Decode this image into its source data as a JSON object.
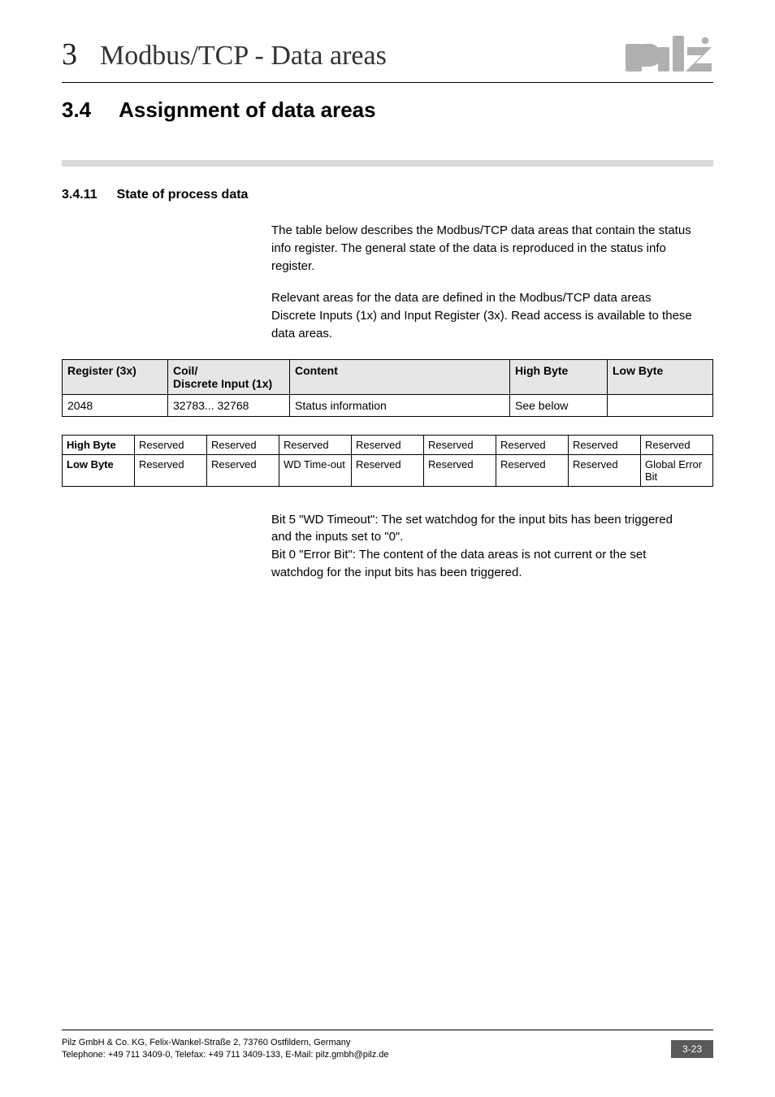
{
  "header": {
    "chapter_num": "3",
    "chapter_title": "Modbus/TCP - Data areas"
  },
  "section": {
    "num": "3.4",
    "title": "Assignment of data areas"
  },
  "subsection": {
    "num": "3.4.11",
    "title": "State of process data"
  },
  "paragraphs": {
    "p1": "The table below describes the Modbus/TCP data areas that contain the status info register. The general state of the data is reproduced in the status info register.",
    "p2": "Relevant areas for the data are defined in the Modbus/TCP data areas Discrete Inputs (1x) and Input Register (3x). Read access is available to these data areas."
  },
  "table1": {
    "headers": {
      "c0": "Register (3x)",
      "c1": "Coil/\nDiscrete Input (1x)",
      "c2": "Content",
      "c3": "High Byte",
      "c4": "Low Byte"
    },
    "row": {
      "c0": "2048",
      "c1": "32783... 32768",
      "c2": "Status information",
      "c3": "See below",
      "c4": ""
    }
  },
  "table2": {
    "rows": [
      {
        "label": "High Byte",
        "cells": [
          "Reserved",
          "Reserved",
          "Reserved",
          "Reserved",
          "Reserved",
          "Reserved",
          "Reserved",
          "Reserved"
        ]
      },
      {
        "label": "Low Byte",
        "cells": [
          "Reserved",
          "Reserved",
          "WD Time-out",
          "Reserved",
          "Reserved",
          "Reserved",
          "Reserved",
          "Global Error Bit"
        ]
      }
    ]
  },
  "notes": {
    "n1": "Bit 5 \"WD Timeout\": The set watchdog for the input bits has been triggered and the inputs set to \"0\".",
    "n2": "Bit 0 \"Error Bit\": The content of the data areas is not current or the set watchdog for the input bits has been triggered."
  },
  "footer": {
    "line1": "Pilz GmbH & Co. KG, Felix-Wankel-Straße 2, 73760 Ostfildern, Germany",
    "line2": "Telephone: +49 711 3409-0, Telefax: +49 711 3409-133, E-Mail: pilz.gmbh@pilz.de",
    "page": "3-23"
  }
}
